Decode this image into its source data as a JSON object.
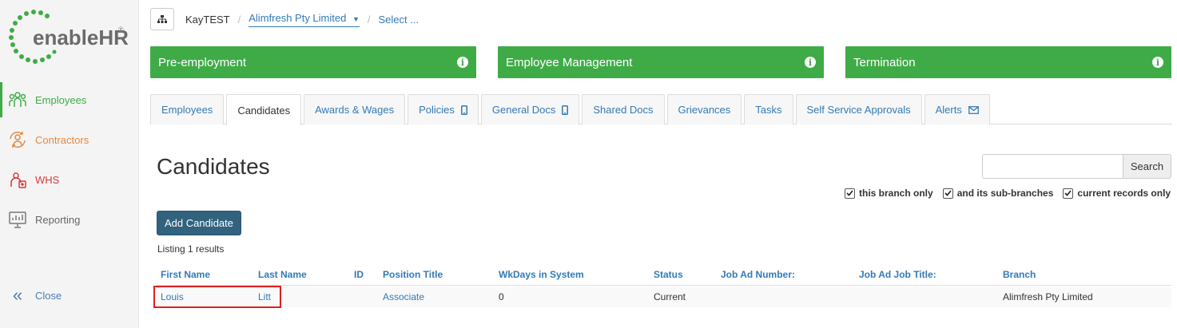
{
  "brand": {
    "name": "enableHR",
    "trademark": "®",
    "accent_green": "#3fab47",
    "link_blue": "#337ab7",
    "button_navy": "#31627e"
  },
  "sidebar": {
    "items": [
      {
        "label": "Employees",
        "icon": "employees-icon",
        "active": true
      },
      {
        "label": "Contractors",
        "icon": "contractors-icon",
        "active": false
      },
      {
        "label": "WHS",
        "icon": "whs-icon",
        "active": false
      },
      {
        "label": "Reporting",
        "icon": "reporting-icon",
        "active": false
      }
    ],
    "close_label": "Close"
  },
  "breadcrumb": {
    "root": "KayTEST",
    "company": "Alimfresh Pty Limited",
    "select": "Select ..."
  },
  "panels": [
    {
      "label": "Pre-employment"
    },
    {
      "label": "Employee Management"
    },
    {
      "label": "Termination"
    }
  ],
  "tabs": [
    {
      "label": "Employees",
      "active": false
    },
    {
      "label": "Candidates",
      "active": true
    },
    {
      "label": "Awards & Wages",
      "active": false
    },
    {
      "label": "Policies",
      "active": false,
      "icon": "mobile-icon"
    },
    {
      "label": "General Docs",
      "active": false,
      "icon": "mobile-icon"
    },
    {
      "label": "Shared Docs",
      "active": false
    },
    {
      "label": "Grievances",
      "active": false
    },
    {
      "label": "Tasks",
      "active": false
    },
    {
      "label": "Self Service Approvals",
      "active": false
    },
    {
      "label": "Alerts",
      "active": false,
      "icon": "envelope-icon"
    }
  ],
  "main": {
    "title": "Candidates",
    "search": {
      "button_label": "Search",
      "value": "",
      "placeholder": ""
    },
    "filters": [
      {
        "label": "this branch only",
        "checked": true
      },
      {
        "label": "and its sub-branches",
        "checked": true
      },
      {
        "label": "current records only",
        "checked": true
      }
    ],
    "add_button_label": "Add Candidate",
    "listing_text": "Listing 1 results"
  },
  "table": {
    "columns": [
      "First Name",
      "Last Name",
      "ID",
      "Position Title",
      "WkDays in System",
      "Status",
      "Job Ad Number:",
      "Job Ad Job Title:",
      "Branch"
    ],
    "rows": [
      {
        "first_name": "Louis",
        "last_name": "Litt",
        "id": "",
        "position_title": "Associate",
        "wkdays": "0",
        "status": "Current",
        "job_ad_number": "",
        "job_ad_title": "",
        "branch": "Alimfresh Pty Limited"
      }
    ]
  }
}
